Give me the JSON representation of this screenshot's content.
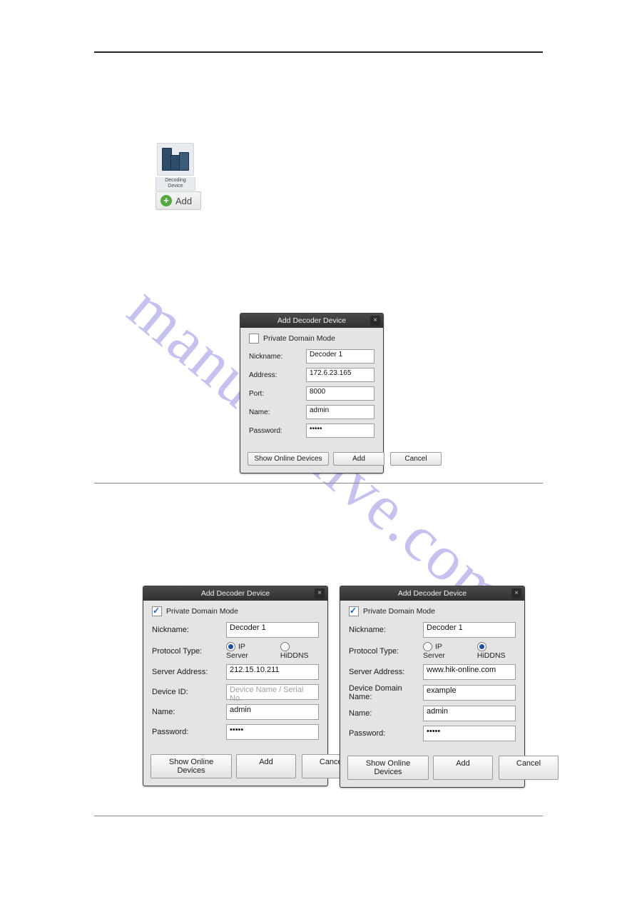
{
  "watermark": "manualshive.com",
  "icon_block": {
    "label_line1": "Decoding",
    "label_line2": "Device"
  },
  "add_button_label": "Add",
  "dialog_common": {
    "title": "Add Decoder Device",
    "close": "×",
    "private_domain_label": "Private Domain Mode",
    "show_online": "Show Online Devices",
    "add": "Add",
    "cancel": "Cancel"
  },
  "dialog1": {
    "private_domain_checked": false,
    "fields": {
      "nickname_label": "Nickname:",
      "nickname": "Decoder 1",
      "address_label": "Address:",
      "address": "172.6.23.165",
      "port_label": "Port:",
      "port": "8000",
      "name_label": "Name:",
      "name": "admin",
      "password_label": "Password:",
      "password": "•••••"
    }
  },
  "dialog2": {
    "private_domain_checked": true,
    "fields": {
      "nickname_label": "Nickname:",
      "nickname": "Decoder 1",
      "protocol_label": "Protocol Type:",
      "protocol_ip_label": "IP Server",
      "protocol_ip_on": true,
      "protocol_hiddns_label": "HiDDNS",
      "protocol_hiddns_on": false,
      "server_address_label": "Server Address:",
      "server_address": "212.15.10.211",
      "device_id_label": "Device ID:",
      "device_id_placeholder": "Device Name / Serial No.",
      "name_label": "Name:",
      "name": "admin",
      "password_label": "Password:",
      "password": "•••••"
    }
  },
  "dialog3": {
    "private_domain_checked": true,
    "fields": {
      "nickname_label": "Nickname:",
      "nickname": "Decoder 1",
      "protocol_label": "Protocol Type:",
      "protocol_ip_label": "IP Server",
      "protocol_ip_on": false,
      "protocol_hiddns_label": "HiDDNS",
      "protocol_hiddns_on": true,
      "server_address_label": "Server Address:",
      "server_address": "www.hik-online.com",
      "device_domain_label": "Device Domain Name:",
      "device_domain": "example",
      "name_label": "Name:",
      "name": "admin",
      "password_label": "Password:",
      "password": "•••••"
    }
  }
}
